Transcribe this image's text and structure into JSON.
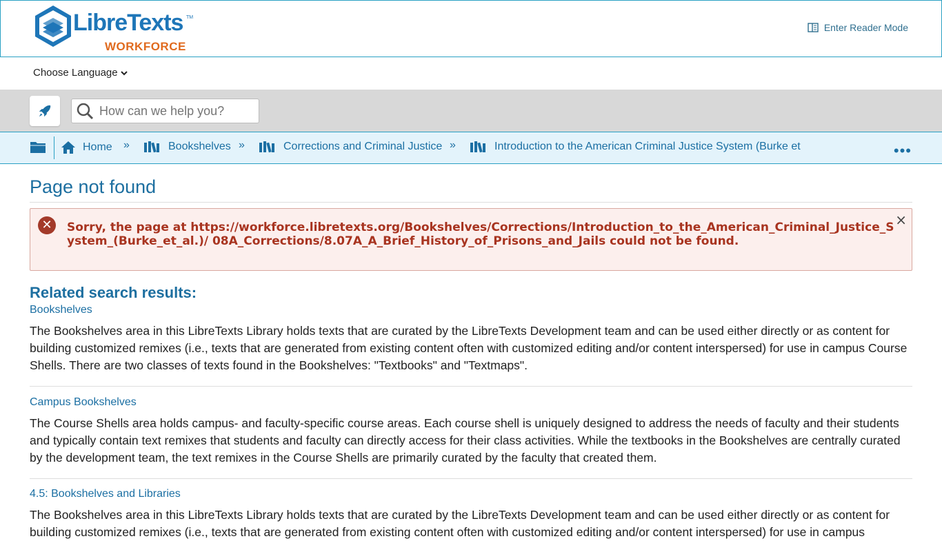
{
  "header": {
    "logo_text": "LibreTexts",
    "logo_tm": "TM",
    "logo_subtitle": "WORKFORCE",
    "reader_mode": "Enter Reader Mode"
  },
  "language": {
    "label": "Choose Language"
  },
  "search": {
    "placeholder": "How can we help you?"
  },
  "breadcrumbs": {
    "home": "Home",
    "items": [
      "Bookshelves",
      "Corrections and Criminal Justice",
      "Introduction to the American Criminal Justice System (Burke et"
    ],
    "more": "•••"
  },
  "page": {
    "title": "Page not found"
  },
  "alert": {
    "icon": "✕",
    "message": "Sorry, the page at https://workforce.libretexts.org/Bookshelves/Corrections/Introduction_to_the_American_Criminal_Justice_System_(Burke_et_al.)/ 08A_Corrections/8.07A_A_Brief_History_of_Prisons_and_Jails could not be found.",
    "close": "×"
  },
  "related": {
    "heading": "Related search results:",
    "results": [
      {
        "title": "Bookshelves",
        "text": "The Bookshelves area in this LibreTexts Library holds texts that are curated by the LibreTexts Development team and can be used either directly or as content for building customized remixes (i.e., texts that are generated from existing content often with customized editing and/or content interspersed) for use in campus Course Shells. There are two classes of texts found in the Bookshelves: \"Textbooks\" and \"Textmaps\"."
      },
      {
        "title": "Campus Bookshelves",
        "text": "The Course Shells area holds campus- and faculty-specific course areas. Each course shell is uniquely designed to address the needs of faculty and their students and typically contain text remixes that students and faculty can directly access for their class activities. While the textbooks in the Bookshelves are centrally curated by the development team, the text remixes in the Course Shells are primarily curated by the faculty that created them."
      },
      {
        "title": "4.5: Bookshelves and Libraries",
        "text": "The Bookshelves area in this LibreTexts Library holds texts that are curated by the LibreTexts Development team and can be used either directly or as content for building customized remixes (i.e., texts that are generated from existing content often with customized editing and/or content interspersed) for use in campus"
      }
    ]
  },
  "colors": {
    "accent": "#1d6fa0",
    "border": "#2aa0c4",
    "alert_text": "#a83420",
    "alert_bg": "#fcefed",
    "logo_orange": "#e06a1e"
  }
}
